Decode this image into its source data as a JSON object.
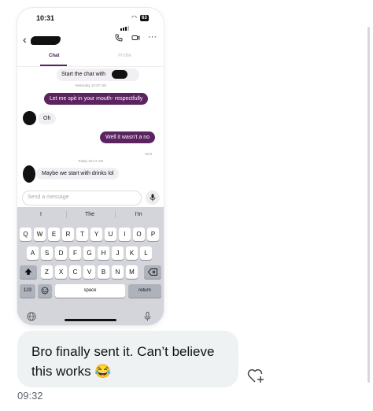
{
  "status_bar": {
    "time": "10:31",
    "battery": "63"
  },
  "tabs": {
    "chat": "Chat",
    "profile": "Profile"
  },
  "chat": {
    "start_chip": "Start the chat with",
    "stamp1": "Yesterday 10:57 AM",
    "msg1": "Let me spit in your mouth- respectfully",
    "msg2": "Oh",
    "msg3": "Well it wasn't a no",
    "sent": "Sent",
    "stamp2": "Today 10:17 AM",
    "msg4": "Maybe we start with drinks lol"
  },
  "input": {
    "placeholder": "Send a message"
  },
  "keyboard": {
    "suggestions": [
      "I",
      "The",
      "I'm"
    ],
    "row1": [
      "Q",
      "W",
      "E",
      "R",
      "T",
      "Y",
      "U",
      "I",
      "O",
      "P"
    ],
    "row2": [
      "A",
      "S",
      "D",
      "F",
      "G",
      "H",
      "J",
      "K",
      "L"
    ],
    "row3": [
      "Z",
      "X",
      "C",
      "V",
      "B",
      "N",
      "M"
    ],
    "numbers": "123",
    "space": "space",
    "return": "return"
  },
  "caption": {
    "text": "Bro finally sent it. Can’t believe this works 😂",
    "time": "09:32"
  },
  "icons": [
    "chevron-left-icon",
    "phone-icon",
    "video-icon",
    "more-icon",
    "mic-icon",
    "shift-icon",
    "backspace-icon",
    "emoji-icon",
    "globe-icon",
    "heart-plus-icon"
  ],
  "colors": {
    "accent": "#5b2360",
    "incoming_bubble": "#f1eff3",
    "caption_bubble": "#eff2f3"
  }
}
